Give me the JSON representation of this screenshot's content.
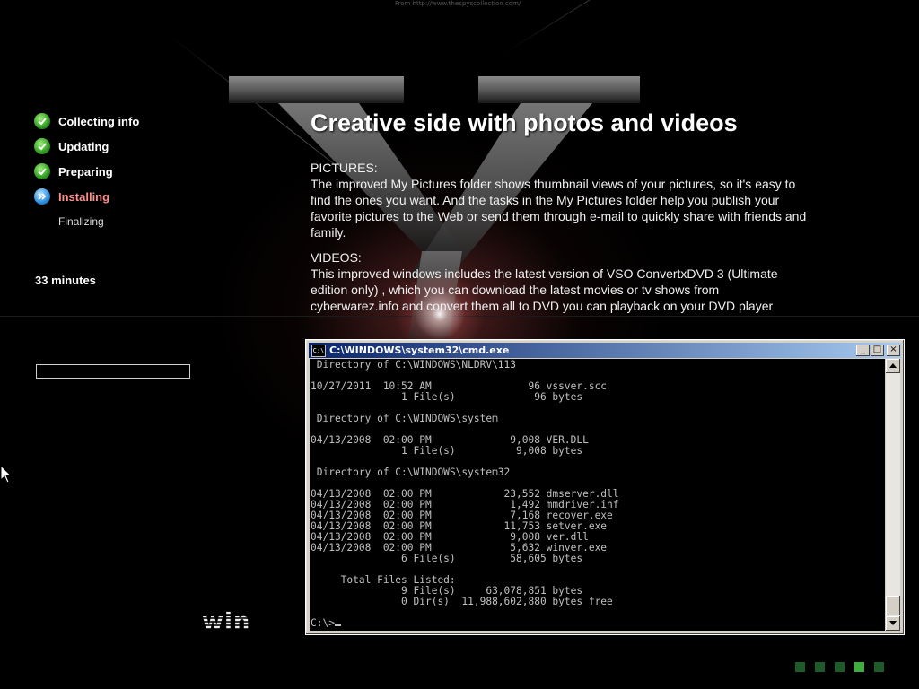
{
  "source_text": "From http://www.thespyscollection.com/",
  "steps": [
    {
      "label": "Collecting info",
      "state": "done",
      "icon": "checkmark-icon"
    },
    {
      "label": "Updating",
      "state": "done",
      "icon": "checkmark-icon"
    },
    {
      "label": "Preparing",
      "state": "done",
      "icon": "checkmark-icon"
    },
    {
      "label": "Installing",
      "state": "current",
      "icon": "forward-arrows-icon"
    },
    {
      "label": "Finalizing",
      "state": "pending",
      "icon": ""
    }
  ],
  "time_remaining": "33 minutes",
  "progress": 0.0,
  "content": {
    "heading": "Creative side with photos and videos",
    "pictures_title": "PICTURES:",
    "pictures_body": "The improved My Pictures folder shows thumbnail views of your pictures, so it's easy to find the ones you want. And the tasks in the My Pictures folder help you publish your favorite pictures to the Web or send them through e-mail to quickly share with friends and family.",
    "videos_title": "VIDEOS:",
    "videos_body": "This improved windows includes the latest version of VSO ConvertxDVD 3 (Ultimate edition only) , which you can download the latest movies or tv shows from cyberwarez.info and convert them all to DVD you can playback on your DVD player"
  },
  "brand_logo_text": "win",
  "cmd": {
    "title": "C:\\WINDOWS\\system32\\cmd.exe",
    "icon_text": "C:\\",
    "lines": [
      " Directory of C:\\WINDOWS\\NLDRV\\113",
      "",
      "10/27/2011  10:52 AM                96 vssver.scc",
      "               1 File(s)             96 bytes",
      "",
      " Directory of C:\\WINDOWS\\system",
      "",
      "04/13/2008  02:00 PM             9,008 VER.DLL",
      "               1 File(s)          9,008 bytes",
      "",
      " Directory of C:\\WINDOWS\\system32",
      "",
      "04/13/2008  02:00 PM            23,552 dmserver.dll",
      "04/13/2008  02:00 PM             1,492 mmdriver.inf",
      "04/13/2008  02:00 PM             7,168 recover.exe",
      "04/13/2008  02:00 PM            11,753 setver.exe",
      "04/13/2008  02:00 PM             9,008 ver.dll",
      "04/13/2008  02:00 PM             5,632 winver.exe",
      "               6 File(s)         58,605 bytes",
      "",
      "     Total Files Listed:",
      "               9 File(s)     63,078,851 bytes",
      "               0 Dir(s)  11,988,602,880 bytes free",
      "",
      "C:\\>"
    ]
  },
  "colors": {
    "done_icon": "#2f9b1f",
    "current_icon": "#2a8ee0",
    "active_label": "#ff8f8f",
    "titlebar_start": "#0a246a",
    "titlebar_end": "#a6caf0",
    "dot_dim": "#1f5a2a",
    "dot_lit": "#3fae3f"
  },
  "page_dots": [
    false,
    false,
    false,
    true,
    false
  ]
}
